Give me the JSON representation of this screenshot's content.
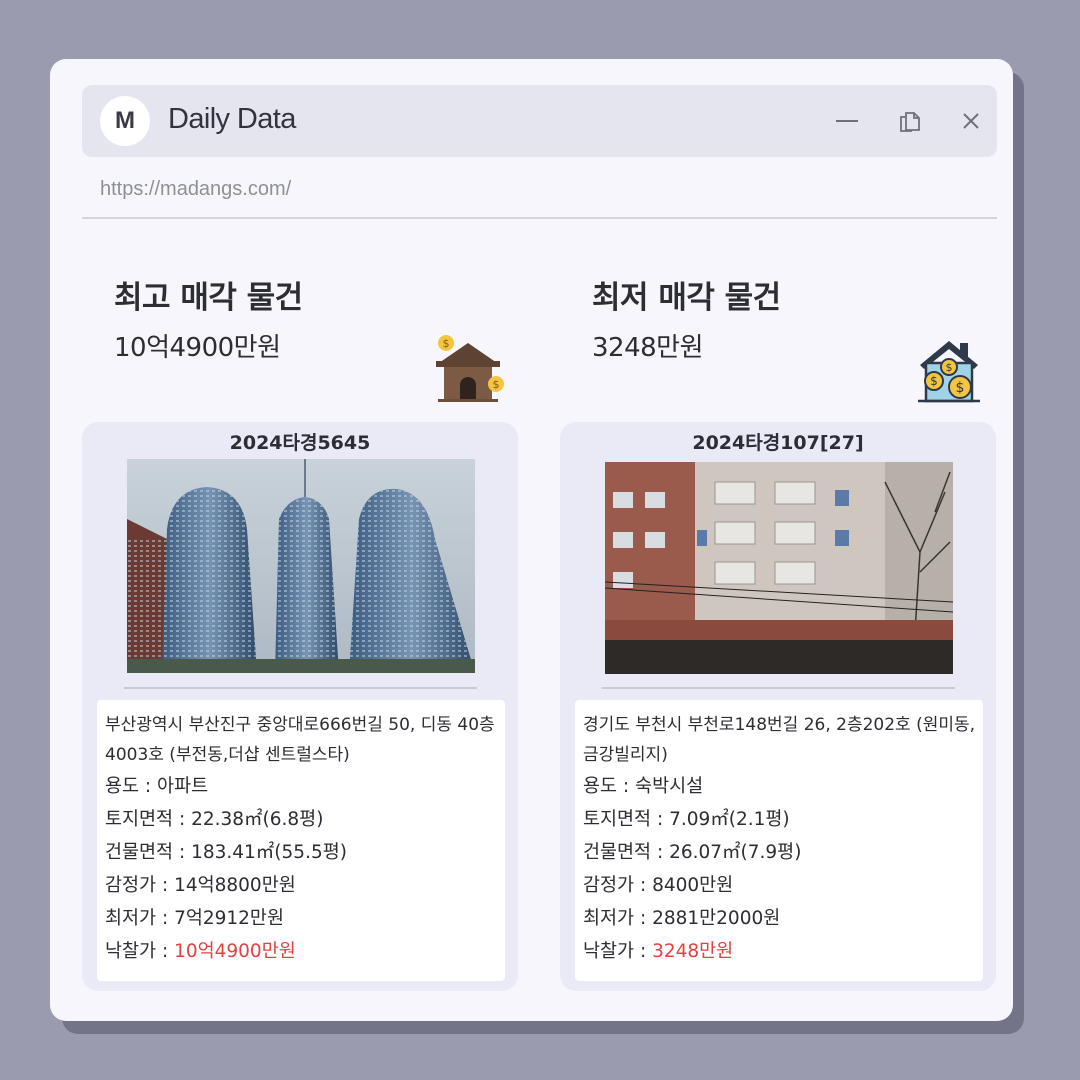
{
  "app": {
    "logo_letter": "M",
    "title": "Daily Data",
    "url": "https://madangs.com/",
    "controls": [
      "minimize-icon",
      "copy-icon",
      "close-icon"
    ]
  },
  "colors": {
    "background": "#9a9bae",
    "window": "#f6f6fc",
    "titlebar": "#e4e5ef",
    "panel": "#e9eaf5",
    "accent_red": "#e04242"
  },
  "highest": {
    "heading": "최고 매각 물건",
    "price": "10억4900만원",
    "icon": "house-with-coins-icon",
    "case_no": "2024타경5645",
    "address": "부산광역시 부산진구 중앙대로666번길 50, 디동 40층4003호 (부전동,더샵 센트럴스타)",
    "usage_label": "용도 : ",
    "usage": "아파트",
    "land_label": "토지면적 : ",
    "land": "22.38㎡(6.8평)",
    "building_label": "건물면적 : ",
    "building": "183.41㎡(55.5평)",
    "appraisal_label": "감정가 : ",
    "appraisal": "14억8800만원",
    "minimum_label": "최저가 : ",
    "minimum": "7억2912만원",
    "winning_label": "낙찰가 : ",
    "winning": "10억4900만원"
  },
  "lowest": {
    "heading": "최저 매각 물건",
    "price": "3248만원",
    "icon": "house-with-coins-icon",
    "case_no": "2024타경107[27]",
    "address": "경기도 부천시 부천로148번길 26, 2층202호 (원미동,금강빌리지)",
    "usage_label": "용도 : ",
    "usage": "숙박시설",
    "land_label": "토지면적 : ",
    "land": "7.09㎡(2.1평)",
    "building_label": "건물면적 : ",
    "building": "26.07㎡(7.9평)",
    "appraisal_label": "감정가 : ",
    "appraisal": "8400만원",
    "minimum_label": "최저가 : ",
    "minimum": "2881만2000원",
    "winning_label": "낙찰가 : ",
    "winning": "3248만원"
  }
}
